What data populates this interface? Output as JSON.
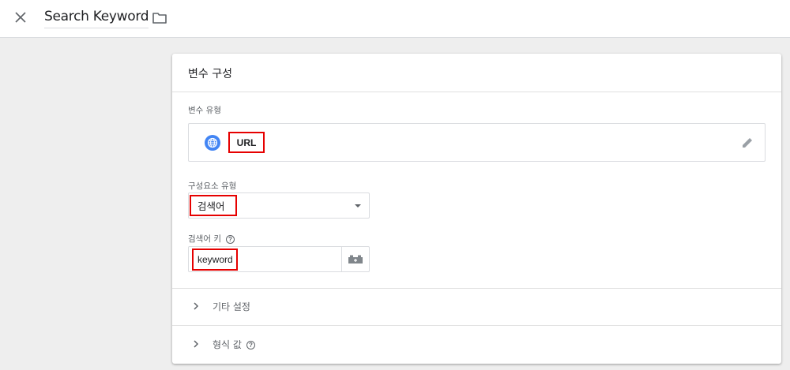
{
  "header": {
    "title": "Search Keyword",
    "close_icon": "close-icon",
    "folder_icon": "folder-icon"
  },
  "card": {
    "title": "변수 구성",
    "variable_type": {
      "label": "변수 유형",
      "value": "URL",
      "icon": "globe-icon",
      "edit_icon": "pencil-icon"
    },
    "component_type": {
      "label": "구성요소 유형",
      "value": "검색어"
    },
    "query_key": {
      "label": "검색어 키",
      "help": "?",
      "value": "keyword",
      "variable_icon": "variable-brick-icon"
    },
    "more_settings": {
      "label": "기타 설정"
    },
    "format_value": {
      "label": "형식 값",
      "help": "?"
    }
  },
  "colors": {
    "highlight": "#e60000",
    "accent": "#4285f4",
    "background": "#eeeeee"
  }
}
